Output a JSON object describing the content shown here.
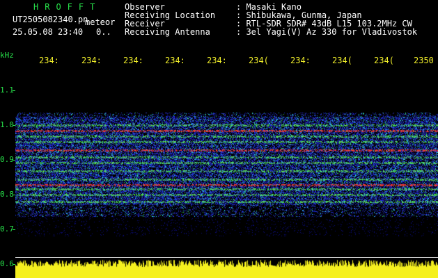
{
  "header": {
    "app_name": "HROFFT",
    "filename": "UT2505082340.pn",
    "file_type": "meteor",
    "date_time": "25.05.08 23:40",
    "counter": "0.."
  },
  "info": {
    "rows": [
      {
        "label": "Observer",
        "value": ": Masaki Kano"
      },
      {
        "label": "Receiving Location",
        "value": ": Shibukawa, Gunma, Japan"
      },
      {
        "label": "Receiver",
        "value": ": RTL-SDR SDR# 43dB L15 103.2MHz CW"
      },
      {
        "label": "Receiving Antenna",
        "value": ": 3el Yagi(V) Az 330 for Vladivostok"
      }
    ]
  },
  "axes": {
    "y_unit": "kHz",
    "y_ticks": [
      "1.1",
      "1.0",
      "0.9",
      "0.8",
      "0.7",
      "0.6"
    ],
    "x_ticks": [
      "234:",
      "234:",
      "234:",
      "234:",
      "234:",
      "234(",
      "234:",
      "234(",
      "234(",
      "2350"
    ]
  },
  "colors": {
    "background": "#000000",
    "label_green": "#27e04a",
    "tick_yellow": "#f0ee2a",
    "meter_yellow": "#f5f01e",
    "noise_blue": "#1a2fd0",
    "signal_red": "#e8323a",
    "signal_green": "#30e060",
    "signal_cyan": "#3ad6d6"
  }
}
